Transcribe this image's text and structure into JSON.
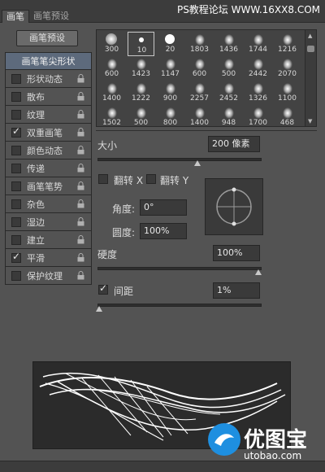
{
  "tabs": [
    {
      "label": "画笔",
      "active": true
    },
    {
      "label": "画笔预设",
      "active": false
    }
  ],
  "watermark": "PS教程论坛 WWW.16XX8.COM",
  "preset_button": "画笔预设",
  "options": {
    "header": "画笔笔尖形状",
    "items": [
      {
        "label": "形状动态",
        "checked": false
      },
      {
        "label": "散布",
        "checked": false
      },
      {
        "label": "纹理",
        "checked": false
      },
      {
        "label": "双重画笔",
        "checked": true
      },
      {
        "label": "颜色动态",
        "checked": false
      },
      {
        "label": "传递",
        "checked": false
      },
      {
        "label": "画笔笔势",
        "checked": false
      },
      {
        "label": "杂色",
        "checked": false
      },
      {
        "label": "湿边",
        "checked": false
      },
      {
        "label": "建立",
        "checked": false
      },
      {
        "label": "平滑",
        "checked": true
      },
      {
        "label": "保护纹理",
        "checked": false
      }
    ]
  },
  "brush_grid": {
    "rows": [
      [
        "300",
        "10",
        "20",
        "1803",
        "1436",
        "1744",
        "1216"
      ],
      [
        "600",
        "1423",
        "1147",
        "600",
        "500",
        "2442",
        "2070"
      ],
      [
        "1400",
        "1222",
        "900",
        "2257",
        "2452",
        "1326",
        "1100"
      ],
      [
        "1502",
        "500",
        "800",
        "1400",
        "948",
        "1700",
        "468"
      ]
    ],
    "selected": "10"
  },
  "size": {
    "label": "大小",
    "value": "200 像素",
    "fraction": 0.62
  },
  "flip_x": {
    "label": "翻转 X",
    "checked": false
  },
  "flip_y": {
    "label": "翻转 Y",
    "checked": false
  },
  "angle": {
    "label": "角度:",
    "value": "0°"
  },
  "roundness": {
    "label": "圆度:",
    "value": "100%"
  },
  "hardness": {
    "label": "硬度",
    "value": "100%",
    "fraction": 1.0
  },
  "spacing": {
    "label": "间距",
    "value": "1%",
    "checked": true,
    "fraction": 0.01
  },
  "logo": {
    "text": "优图宝",
    "url": "utobao.com"
  },
  "colors": {
    "panel": "#535353",
    "header_selected": "#5d6a7c",
    "dark": "#3a3a3a"
  }
}
